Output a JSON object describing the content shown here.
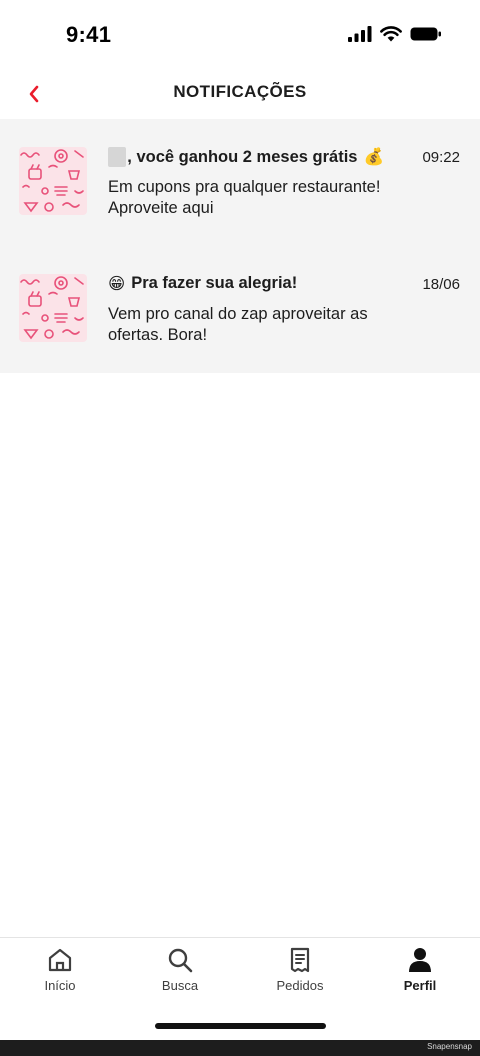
{
  "status_bar": {
    "time": "9:41"
  },
  "header": {
    "title": "NOTIFICAÇÕES",
    "back_icon": "chevron-left-icon"
  },
  "notifications": [
    {
      "title_suffix": ", você ganhou 2 meses grátis",
      "title_emoji": "💰",
      "time": "09:22",
      "body": "Em cupons pra qualquer restaurante! Aproveite aqui"
    },
    {
      "title_prefix_emoji": "😁",
      "title": "Pra fazer sua alegria!",
      "time": "18/06",
      "body": "Vem pro canal do zap aproveitar as ofertas. Bora!"
    }
  ],
  "bottom_nav": {
    "items": [
      {
        "label": "Início",
        "icon": "home-icon"
      },
      {
        "label": "Busca",
        "icon": "search-icon"
      },
      {
        "label": "Pedidos",
        "icon": "receipt-icon"
      },
      {
        "label": "Perfil",
        "icon": "profile-icon",
        "active": true
      }
    ]
  },
  "watermark": "Snapensnap",
  "colors": {
    "accent": "#ea1d2c",
    "list_bg": "#f4f4f4",
    "thumb_bg": "#fbe3e8",
    "thumb_doodle": "#e8527a"
  }
}
